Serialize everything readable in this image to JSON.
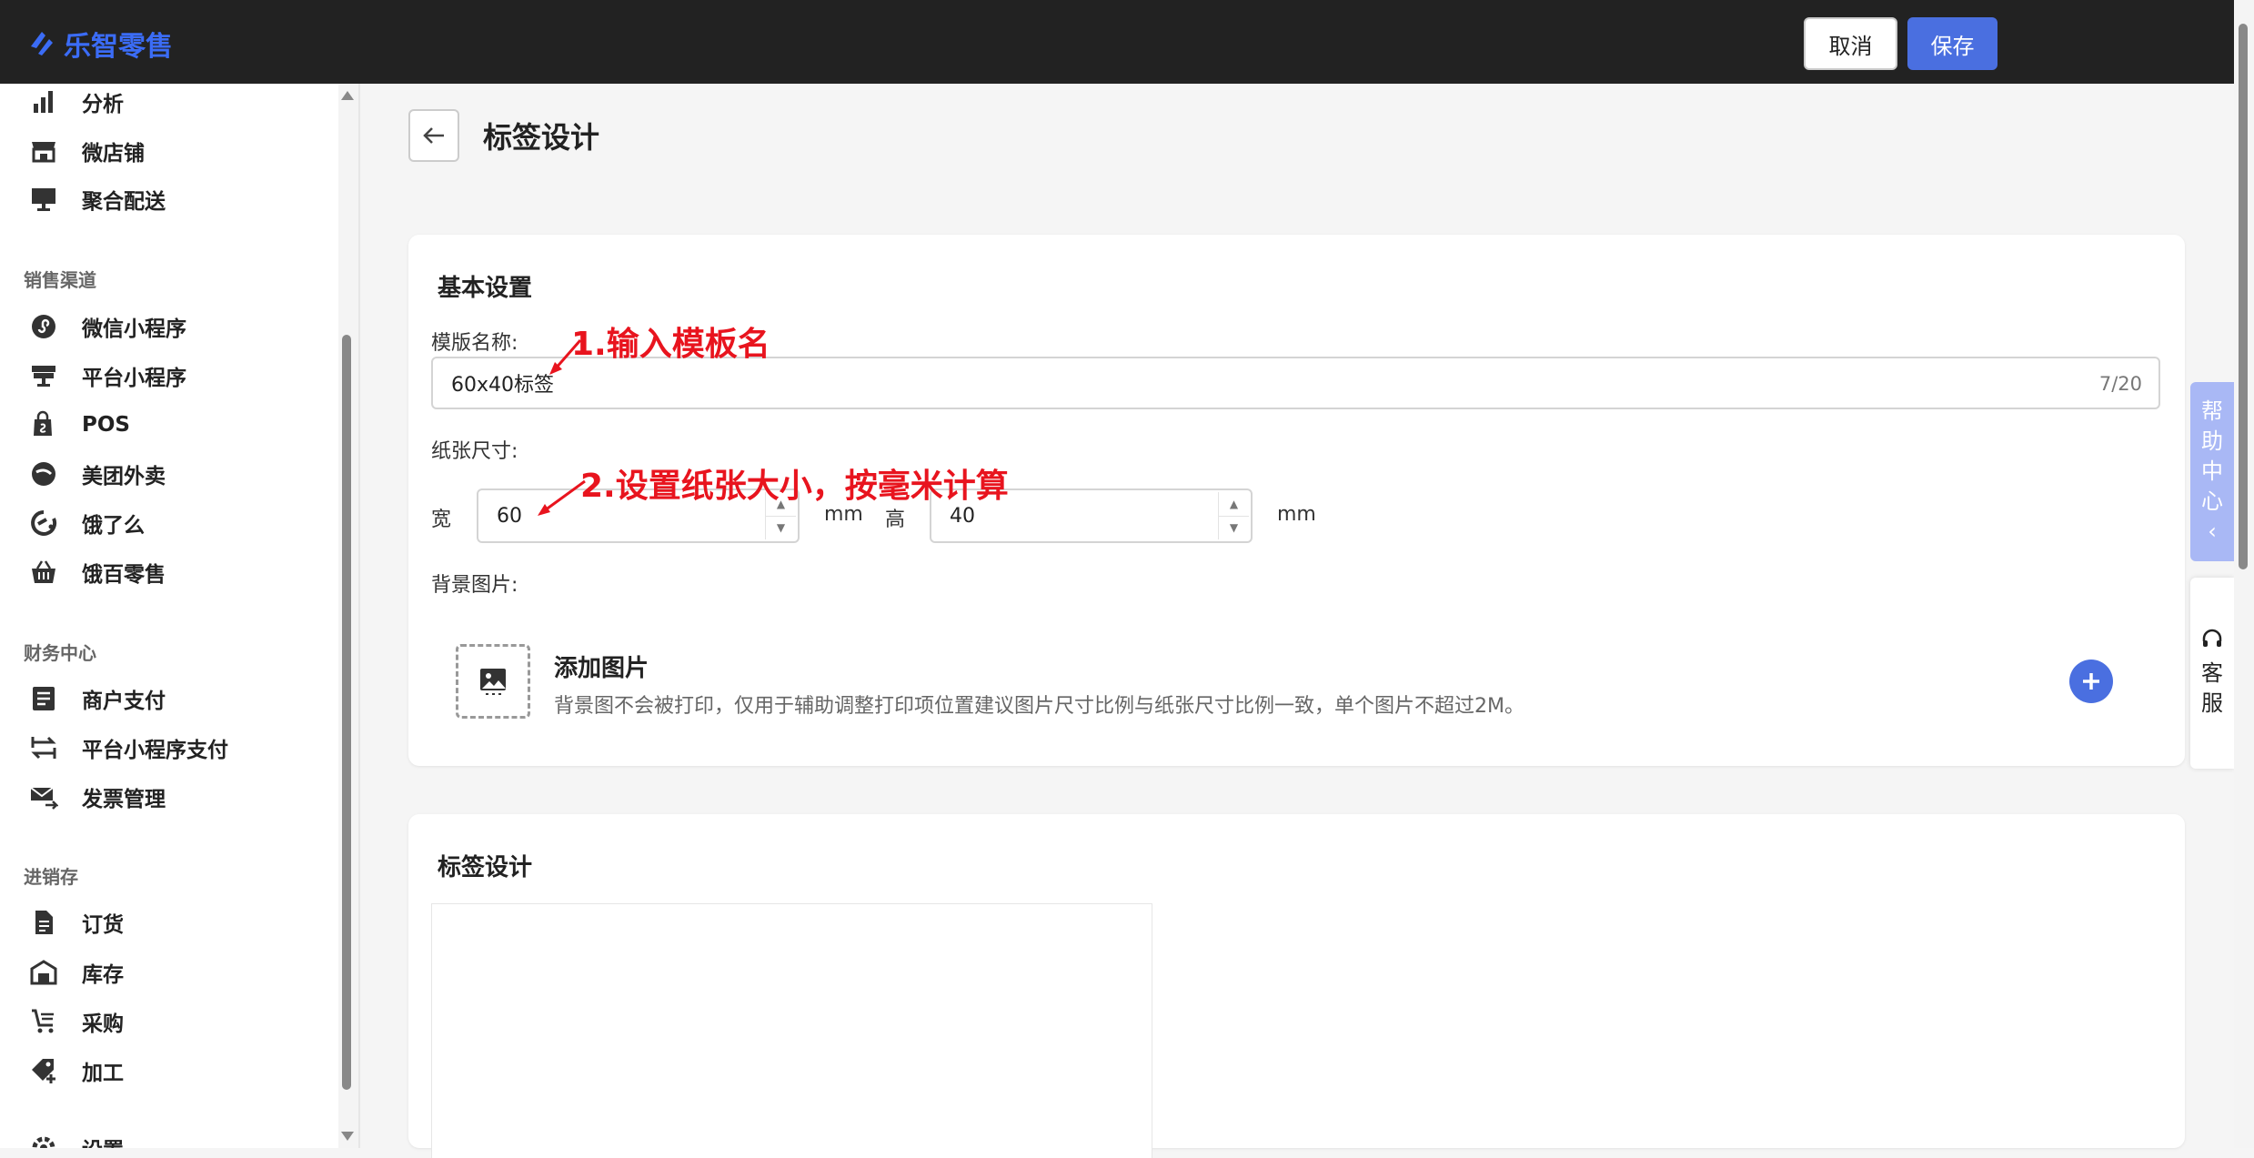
{
  "header": {
    "brand": "乐智零售",
    "cancel_label": "取消",
    "save_label": "保存"
  },
  "sidebar": {
    "top_items": [
      {
        "label": "分析",
        "icon": "bar-chart-icon"
      },
      {
        "label": "微店铺",
        "icon": "storefront-icon"
      },
      {
        "label": "聚合配送",
        "icon": "monitor-icon"
      }
    ],
    "groups": [
      {
        "title": "销售渠道",
        "items": [
          {
            "label": "微信小程序",
            "icon": "miniprogram-icon"
          },
          {
            "label": "平台小程序",
            "icon": "store-icon"
          },
          {
            "label": "POS",
            "icon": "shopping-bag-icon"
          },
          {
            "label": "美团外卖",
            "icon": "meituan-icon"
          },
          {
            "label": "饿了么",
            "icon": "eleme-icon"
          },
          {
            "label": "饿百零售",
            "icon": "basket-icon"
          }
        ]
      },
      {
        "title": "财务中心",
        "items": [
          {
            "label": "商户支付",
            "icon": "list-card-icon"
          },
          {
            "label": "平台小程序支付",
            "icon": "transfer-icon"
          },
          {
            "label": "发票管理",
            "icon": "mail-send-icon"
          }
        ]
      },
      {
        "title": "进销存",
        "items": [
          {
            "label": "订货",
            "icon": "document-icon"
          },
          {
            "label": "库存",
            "icon": "warehouse-icon"
          },
          {
            "label": "采购",
            "icon": "cart-list-icon"
          },
          {
            "label": "加工",
            "icon": "tag-plus-icon"
          }
        ]
      }
    ],
    "bottom_item": {
      "label": "设置",
      "icon": "gear-icon"
    }
  },
  "page": {
    "title": "标签设计"
  },
  "basic_settings": {
    "title": "基本设置",
    "template_name_label": "模版名称:",
    "template_name_value": "60x40标签",
    "template_name_counter": "7/20",
    "paper_size_label": "纸张尺寸:",
    "width_label": "宽",
    "width_value": "60",
    "width_unit": "mm",
    "height_label": "高",
    "height_value": "40",
    "height_unit": "mm",
    "bg_image_label": "背景图片:",
    "add_image_title": "添加图片",
    "add_image_desc": "背景图不会被打印，仅用于辅助调整打印项位置建议图片尺寸比例与纸张尺寸比例一致，单个图片不超过2M。"
  },
  "label_design": {
    "title": "标签设计"
  },
  "annotations": {
    "step1": "1.输入模板名",
    "step2": "2.设置纸张大小，按毫米计算",
    "color": "#e8141e"
  },
  "right_tabs": {
    "help": [
      "帮",
      "助",
      "中",
      "心"
    ],
    "help_chevron": "‹",
    "service": [
      "客",
      "服"
    ]
  },
  "colors": {
    "accent": "#4a6fe0",
    "topbar": "#222222",
    "brand": "#3b6cf6"
  }
}
